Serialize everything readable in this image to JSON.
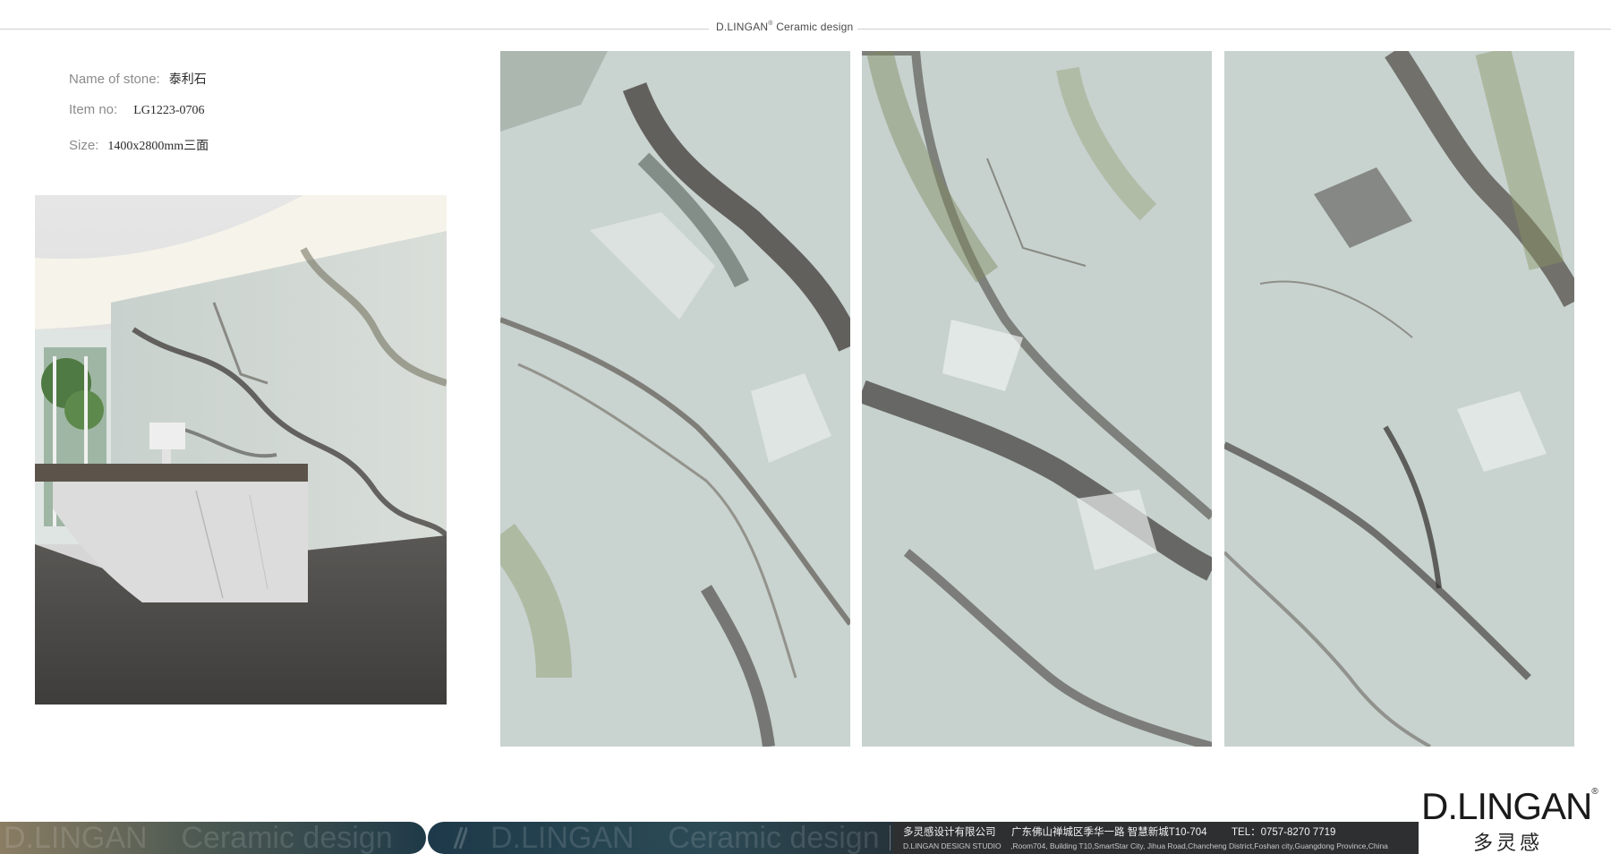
{
  "header": {
    "brand": "D.LINGAN",
    "trademark": "®",
    "tagline": "Ceramic design"
  },
  "specs": {
    "name_label": "Name  of stone:",
    "name_value": "泰利石",
    "item_label": "Item no:",
    "item_value": "LG1223-0706",
    "size_label": "Size:",
    "size_value": "1400x2800mm三面"
  },
  "logo": {
    "text": "D.LINGAN",
    "trademark": "®",
    "chinese": "多灵感"
  },
  "footer": {
    "ghost_brand_1": "D.LINGAN",
    "ghost_tagline_1": "Ceramic design",
    "ghost_brand_2": "D.LINGAN",
    "ghost_tagline_2": "Ceramic design",
    "company_cn": "多灵感设计有限公司",
    "address_cn": "广东佛山禅城区季华一路  智慧新城T10-704",
    "tel": "TEL：0757-8270 7719",
    "company_en": "D.LINGAN DESIGN STUDIO",
    "address_en": ",Room704, Building T10,SmartStar City, Jihua Road,Chancheng  District,Foshan  city,Guangdong Province,China"
  },
  "colors": {
    "stone_base": "#c9d4d1",
    "vein_dark": "#3f3a37",
    "vein_green": "#8c9a6c",
    "floor": "#4d4b48"
  }
}
